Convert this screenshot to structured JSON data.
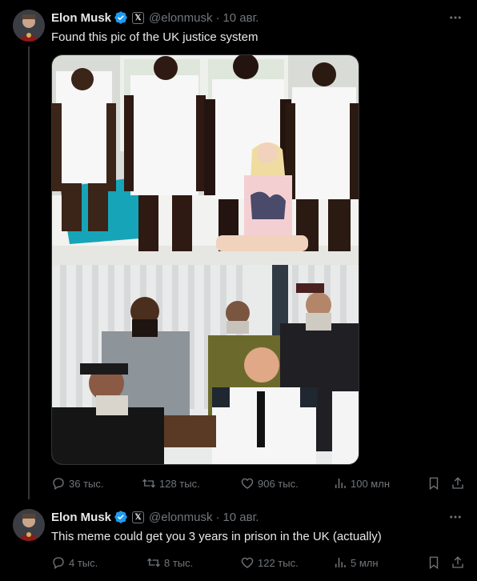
{
  "colors": {
    "background": "#000000",
    "text": "#e7e9ea",
    "secondary": "#71767b",
    "verified": "#1d9bf0",
    "border": "#2f3336"
  },
  "tweets": [
    {
      "name": "Elon Musk",
      "handle": "@elonmusk",
      "separator": "·",
      "date": "10 авг.",
      "text": "Found this pic of the UK justice system",
      "has_media": true,
      "stats": {
        "replies": "36 тыс.",
        "reposts": "128 тыс.",
        "likes": "906 тыс.",
        "views": "100 млн"
      }
    },
    {
      "name": "Elon Musk",
      "handle": "@elonmusk",
      "separator": "·",
      "date": "10 авг.",
      "text": "This meme could get you 3 years in prison in the UK (actually)",
      "has_media": false,
      "stats": {
        "replies": "4 тыс.",
        "reposts": "8 тыс.",
        "likes": "122 тыс.",
        "views": "5 млн"
      }
    }
  ],
  "icons": [
    "verified-badge-icon",
    "x-affiliate-icon",
    "more-icon",
    "reply-icon",
    "repost-icon",
    "like-icon",
    "views-icon",
    "bookmark-icon",
    "share-icon"
  ]
}
